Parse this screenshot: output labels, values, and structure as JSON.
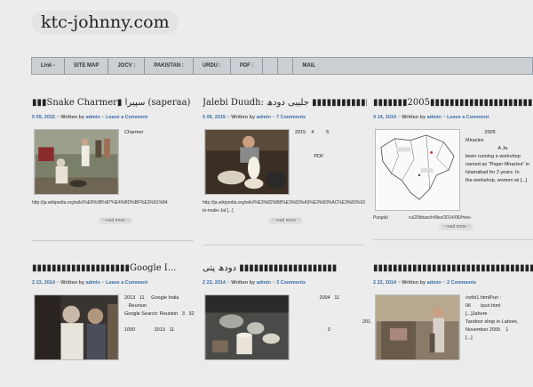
{
  "site": {
    "title": "ktc-johnny.com"
  },
  "nav": [
    "Link -",
    "SITE MAP",
    "JOCV :",
    "PAKISTAN :",
    "URDU :",
    "PDF :",
    "",
    "",
    "MAIL"
  ],
  "posts": [
    {
      "title": "▮▮▮Snake Charmer▮ سپیرا (saperaa)",
      "date": "5 09, 2015",
      "author": "admin",
      "comments": "Leave a Comment",
      "side": "Charmer",
      "under": "http://ja.wikipedia.org/wiki/%E8%9B%87%E4%BD%BF%E3%81%84",
      "readmore": "~ read more ~"
    },
    {
      "title": "Jalebi Duudh: جلیبی دودھ ▮▮▮▮▮▮▮▮▮▮▮▮▮▮▮▮▮▮...",
      "date": "5 06, 2015",
      "author": "admin",
      "comments": "7 Comments",
      "side": "2015    4         5\n\n\n              PDF",
      "under": "http://ja.wikipedia.org/wiki/%E3%82%B8%E3%83%A3%E3%83%AC%E3%83%93\nto-make-Jal [...]",
      "readmore": "~ read more ~"
    },
    {
      "title": "▮▮▮▮▮▮▮2005▮▮▮▮▮▮▮▮▮▮▮▮▮▮▮▮▮▮▮▮▮▮▮▮▮...",
      "date": "4 14, 2014",
      "author": "admin",
      "comments": "Leave a Comment",
      "side": "              2005\nMiracles\n                        A Ja\nbeen running a workshop\nnamed as \"Peper Miracles\" in\nIslamabad for 2 years. In\nthe workshop, women wi [...]",
      "under": "Punjabi                 ru/20bhasch/files/2014/06/How-",
      "readmore": "~ read more ~"
    },
    {
      "title": "▮▮▮▮▮▮▮▮▮▮▮▮▮▮▮▮▮▮▮▮Google I...",
      "date": "2 23, 2014",
      "author": "admin",
      "comments": "Leave a Comment",
      "side": "2013   11     Google India\n   Reunion\nGoogle Search: Reunion   3   32\n\n1000              2013   11"
    },
    {
      "title": "دودھ پتی ▮▮▮▮▮▮▮▮▮▮▮▮▮▮▮▮▮▮▮▮",
      "date": "2 23, 2014",
      "author": "admin",
      "comments": "3 Comments",
      "side": "                  2004   11\n\n\n\n                        3",
      "side2": "201"
    },
    {
      "title": "▮▮▮▮▮▮▮▮▮▮▮▮▮▮▮▮▮▮▮▮▮▮▮▮▮▮▮▮▮▮▮▮▮▮",
      "date": "2 22, 2014",
      "author": "admin",
      "comments": "2 Comments",
      "side": "/rothi1.htmlPuri :\n06       /puri.html\n[...]Jahore\nTandoor shop in Lahore,\nNovember 2005    1\n[...]"
    }
  ],
  "labels": {
    "written_by": "Written by",
    "separator": "~"
  },
  "colors": {
    "accent": "#3a6da8",
    "background": "#ececec",
    "nav": "#c9cfd2"
  }
}
